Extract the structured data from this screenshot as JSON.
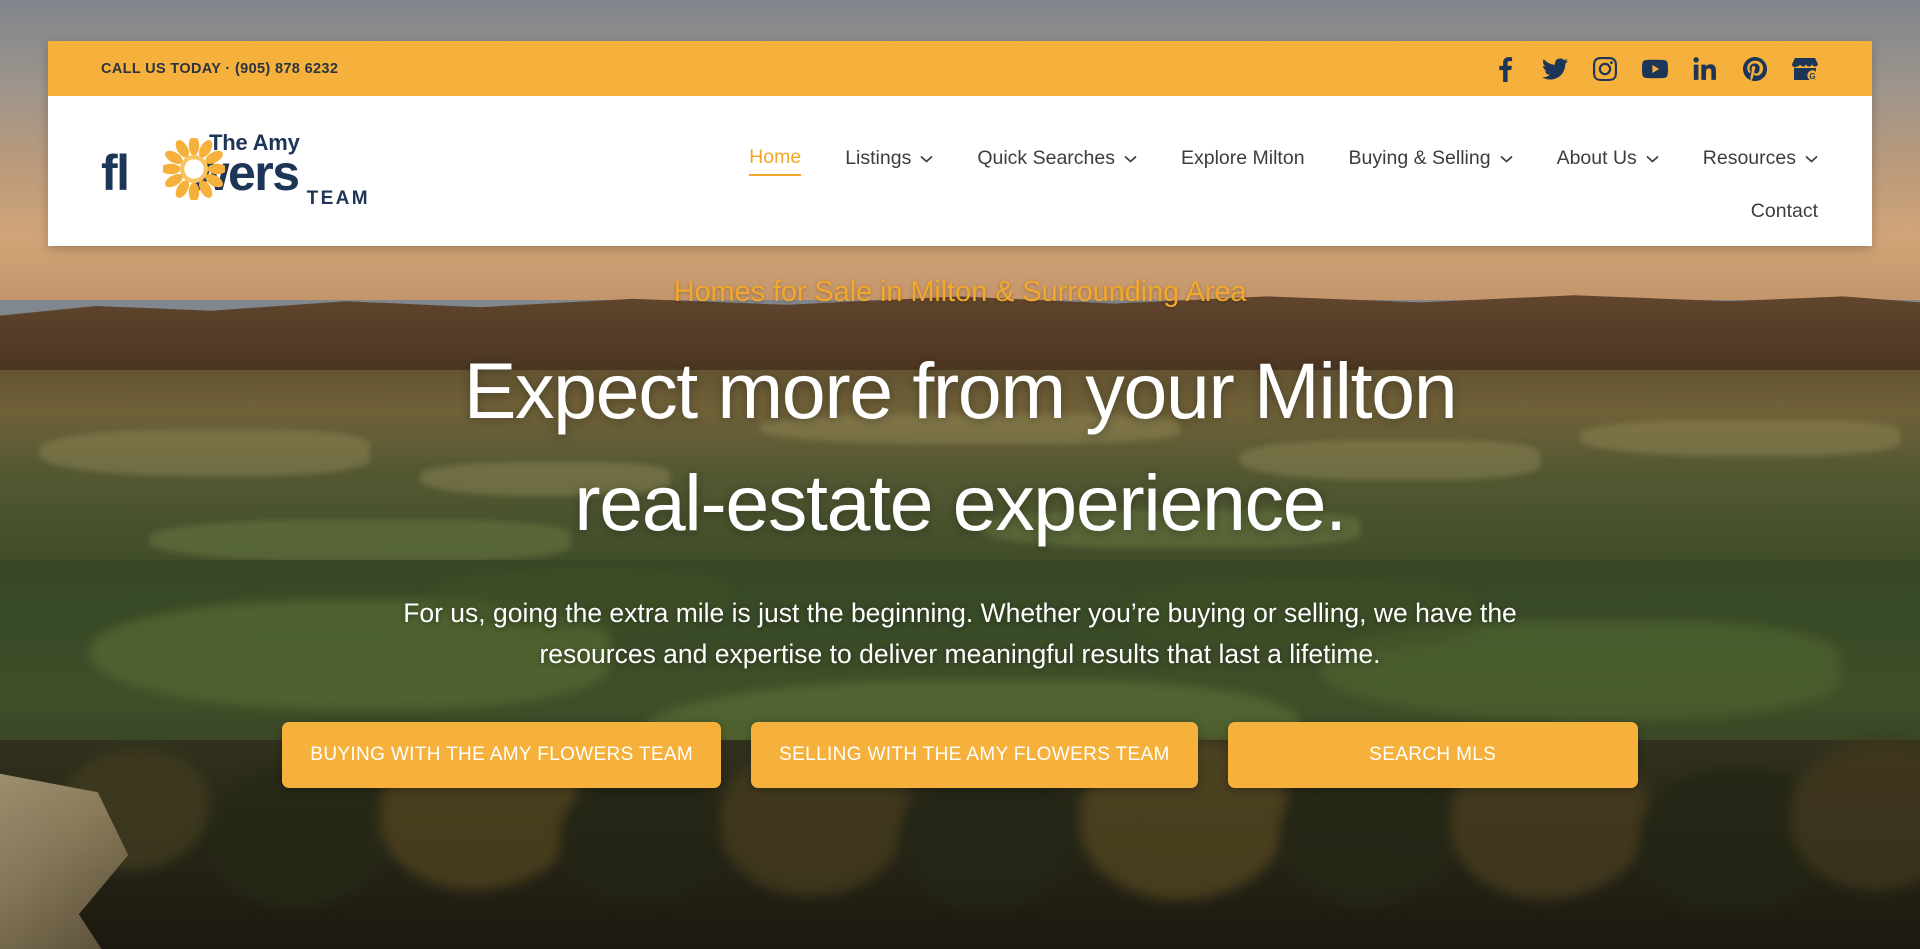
{
  "topbar": {
    "call_text": "CALL US TODAY · (905) 878 6232",
    "phone": "(905) 878 6232",
    "bg_color": "#f5b13c",
    "text_color": "#2b3340",
    "socials": [
      {
        "name": "facebook",
        "label": "Facebook"
      },
      {
        "name": "twitter",
        "label": "Twitter"
      },
      {
        "name": "instagram",
        "label": "Instagram"
      },
      {
        "name": "youtube",
        "label": "YouTube"
      },
      {
        "name": "linkedin",
        "label": "LinkedIn"
      },
      {
        "name": "pinterest",
        "label": "Pinterest"
      },
      {
        "name": "google-business",
        "label": "Google Business Profile"
      }
    ]
  },
  "logo": {
    "line_top": "The Amy",
    "line_main_pre": "fl",
    "line_main_post": "wers",
    "line_bottom": "TEAM",
    "color": "#1d3557",
    "flower_color": "#f5b13c"
  },
  "nav": {
    "active": "Home",
    "accent_color": "#f5a623",
    "items": [
      {
        "label": "Home",
        "has_dropdown": false,
        "active": true
      },
      {
        "label": "Listings",
        "has_dropdown": true,
        "active": false
      },
      {
        "label": "Quick Searches",
        "has_dropdown": true,
        "active": false
      },
      {
        "label": "Explore Milton",
        "has_dropdown": false,
        "active": false
      },
      {
        "label": "Buying & Selling",
        "has_dropdown": true,
        "active": false
      },
      {
        "label": "About Us",
        "has_dropdown": true,
        "active": false
      },
      {
        "label": "Resources",
        "has_dropdown": true,
        "active": false
      },
      {
        "label": "Contact",
        "has_dropdown": false,
        "active": false
      }
    ]
  },
  "hero": {
    "eyebrow": "Homes for Sale in Milton & Surrounding Area",
    "eyebrow_color": "#f3a82b",
    "headline_line1": "Expect more from your Milton",
    "headline_line2": "real-estate experience.",
    "subcopy": "For us, going the extra mile is just the beginning. Whether you’re buying or selling, we have the resources and expertise to deliver meaningful results that last a lifetime.",
    "buttons": [
      {
        "label": "BUYING WITH THE AMY FLOWERS TEAM"
      },
      {
        "label": "SELLING WITH THE AMY FLOWERS TEAM"
      },
      {
        "label": "SEARCH MLS"
      }
    ],
    "button_color": "#f5b13c"
  }
}
